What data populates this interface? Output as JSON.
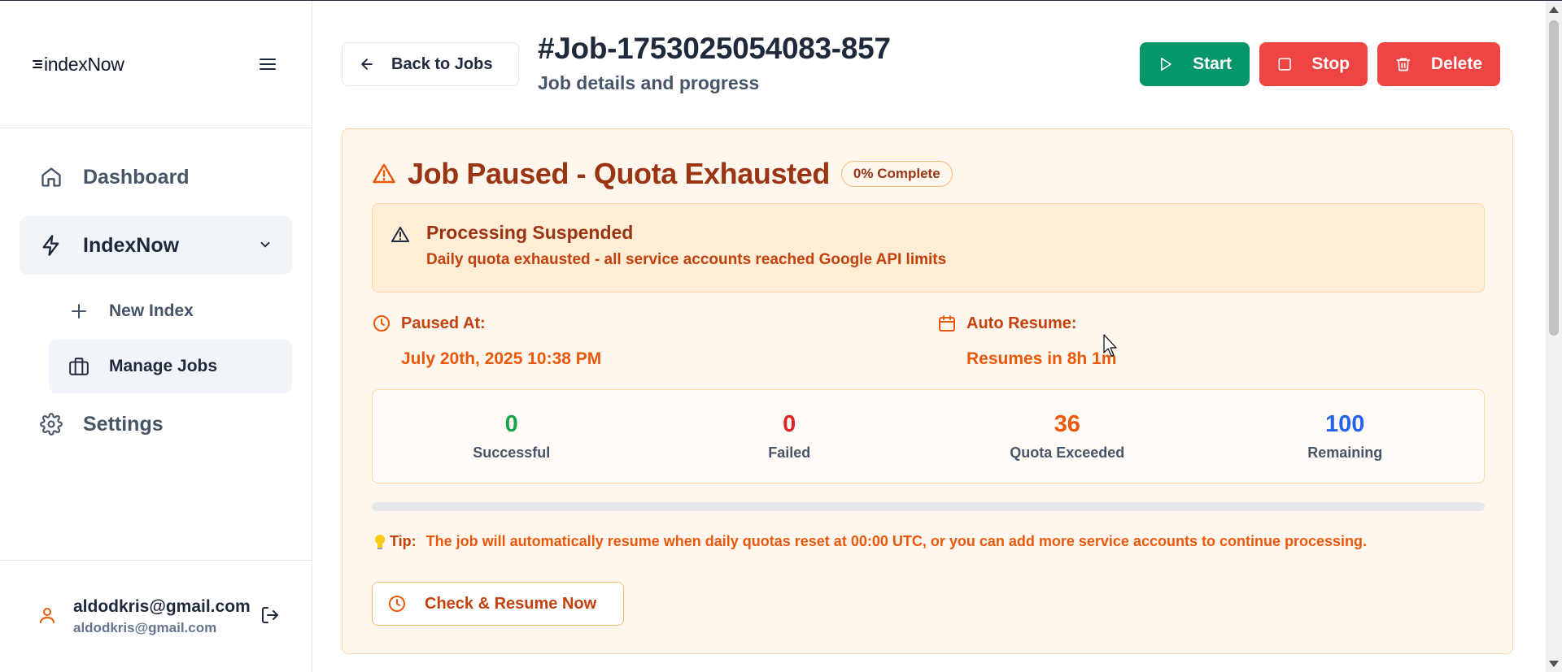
{
  "sidebar": {
    "logo_text": "indexNow",
    "menu_icon": "hamburger-icon",
    "items": [
      {
        "label": "Dashboard",
        "icon": "home-icon"
      },
      {
        "label": "IndexNow",
        "icon": "zap-icon",
        "active": true,
        "expanded": true
      },
      {
        "label": "Settings",
        "icon": "gear-icon"
      }
    ],
    "sub_items": [
      {
        "label": "New Index",
        "icon": "plus-icon"
      },
      {
        "label": "Manage Jobs",
        "icon": "briefcase-icon",
        "active": true
      }
    ],
    "user": {
      "name": "aldodkris@gmail.com",
      "email": "aldodkris@gmail.com"
    }
  },
  "header": {
    "back_label": "Back to Jobs",
    "title": "#Job-1753025054083-857",
    "subtitle": "Job details and progress",
    "actions": {
      "start": "Start",
      "stop": "Stop",
      "delete": "Delete"
    }
  },
  "status_panel": {
    "title": "Job Paused - Quota Exhausted",
    "badge": "0% Complete",
    "progress_percent": 0,
    "alert": {
      "title": "Processing Suspended",
      "description": "Daily quota exhausted - all service accounts reached Google API limits"
    },
    "paused_at": {
      "label": "Paused At:",
      "value": "July 20th, 2025 10:38 PM"
    },
    "auto_resume": {
      "label": "Auto Resume:",
      "value": "Resumes in 8h 1m"
    },
    "stats": [
      {
        "value": "0",
        "label": "Successful",
        "color": "#16a34a"
      },
      {
        "value": "0",
        "label": "Failed",
        "color": "#dc2626"
      },
      {
        "value": "36",
        "label": "Quota Exceeded",
        "color": "#ea580c"
      },
      {
        "value": "100",
        "label": "Remaining",
        "color": "#2563eb"
      }
    ],
    "tip": {
      "label": "Tip:",
      "text": "The job will automatically resume when daily quotas reset at 00:00 UTC, or you can add more service accounts to continue processing."
    },
    "resume_button": "Check & Resume Now"
  },
  "colors": {
    "accent_orange": "#ea580c",
    "start_green": "#059669",
    "danger_red": "#ef4444"
  }
}
